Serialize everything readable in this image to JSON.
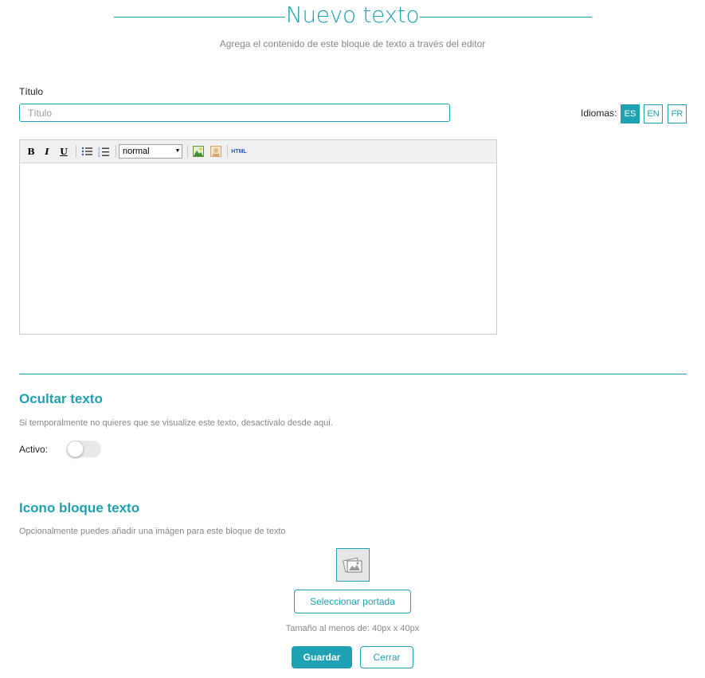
{
  "header": {
    "title": "Nuevo texto",
    "subtitle": "Agrega el contenido de este bloque de texto a través del editor"
  },
  "title_field": {
    "label": "Título",
    "placeholder": "Título",
    "value": ""
  },
  "languages": {
    "label": "Idiomas:",
    "items": [
      "ES",
      "EN",
      "FR"
    ],
    "active": "ES"
  },
  "editor": {
    "toolbar": {
      "bold": "B",
      "italic": "I",
      "underline": "U",
      "format_select": "normal",
      "html": "HTML",
      "icons": [
        "bold-icon",
        "italic-icon",
        "underline-icon",
        "bullet-list-icon",
        "numbered-list-icon",
        "insert-image-icon",
        "insert-media-icon",
        "html-source-icon"
      ]
    },
    "content": ""
  },
  "hide_section": {
    "title": "Ocultar texto",
    "description": "Si temporalmente no quieres que se visualize este texto, desactivalo desde aqui.",
    "toggle_label": "Activo:",
    "active": false
  },
  "icon_section": {
    "title": "Icono bloque texto",
    "description": "Opcionalmente puedes añadir una imágen para este bloque de texto",
    "select_button": "Seleccionar portada",
    "size_hint": "Tamaño al menos de: 40px x 40px"
  },
  "actions": {
    "save": "Guardar",
    "close": "Cerrar"
  },
  "colors": {
    "accent": "#1ea1b3",
    "muted_text": "#888888",
    "toolbar_bg": "#f0f0f0"
  }
}
